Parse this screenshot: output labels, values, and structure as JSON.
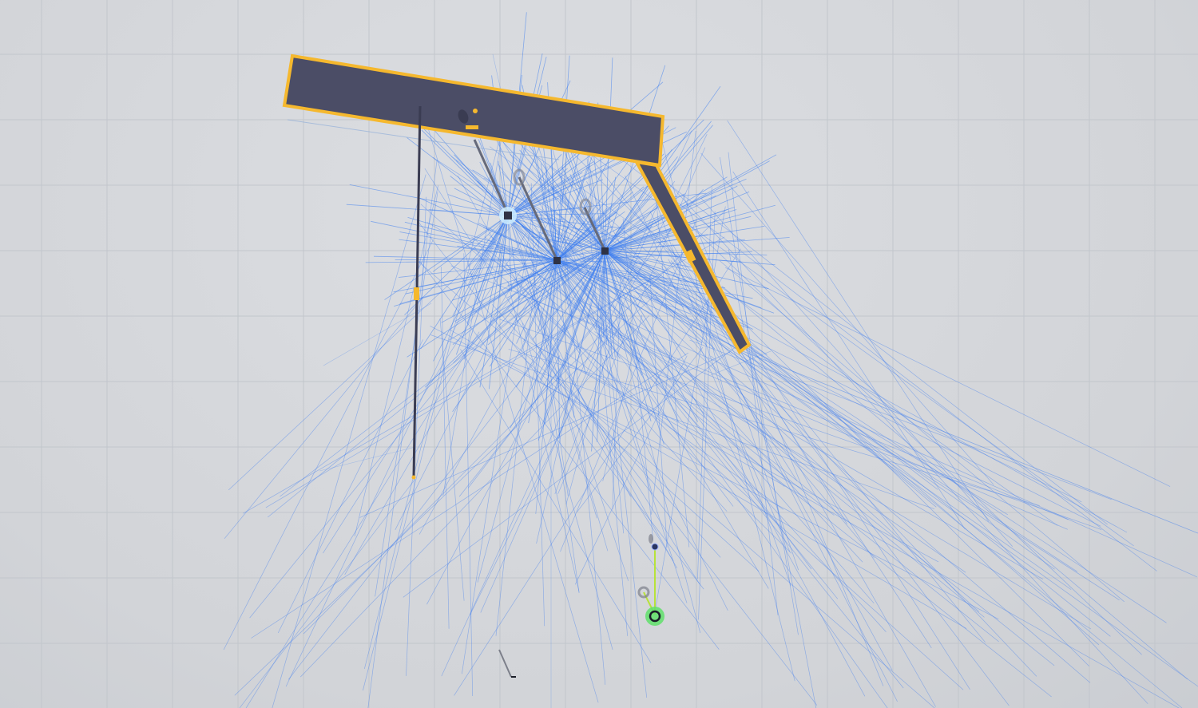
{
  "view": {
    "type": "3d-scene-editor-viewport",
    "background_color": "#d6d8dc",
    "grid_color": "#c2c6cc",
    "selection_color": "#f5b82e",
    "wall_color": "#4b4d66",
    "ray_color": "#3d7df0",
    "highlight_color": "#5fe06a"
  },
  "objects": [
    {
      "name": "wall-top",
      "selected": true
    },
    {
      "name": "wall-right",
      "selected": true
    },
    {
      "name": "wall-left-thin",
      "selected": false
    },
    {
      "name": "light-emitter-1",
      "selected": true
    },
    {
      "name": "light-emitter-2",
      "selected": false
    },
    {
      "name": "light-emitter-3",
      "selected": false
    },
    {
      "name": "player-target",
      "selected": false
    }
  ]
}
